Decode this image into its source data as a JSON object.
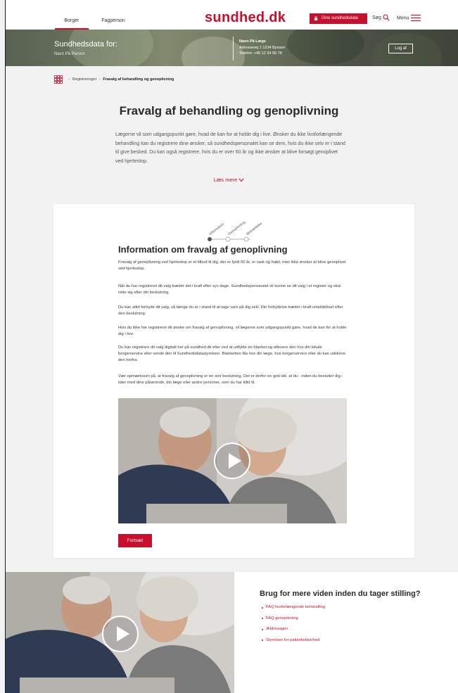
{
  "header": {
    "tabs": [
      {
        "label": "Borger",
        "active": true
      },
      {
        "label": "Fagperson",
        "active": false
      }
    ],
    "logo": "sundhed.dk",
    "my_data_button": "Dine sundhedsdata",
    "search_label": "Søg",
    "menu_label": "Menu",
    "accent_color": "#c8102e"
  },
  "banner": {
    "title": "Sundhedsdata for:",
    "person_name": "Navn På Person",
    "doctor": {
      "name": "Navn På Læge",
      "address": "Adressevej 1 1234 Bynavn",
      "phone": "Telefon: +45 12 34 56 78"
    },
    "logout_button": "Log af"
  },
  "breadcrumb": {
    "items": [
      "Registreringer",
      "Fravalg af behandling og genoplivning"
    ]
  },
  "intro": {
    "title": "Fravalg af behandling og genoplivning",
    "text": "Lægerne vil som udgangspunkt gøre, hvad de kan for at holde dig i live. Ønsker du ikke livsforlængende behandling kan du registrere dine ønsker, så sundhedspersonalet kan se dem, hvis du ikke selv er i stand til give besked. Du kan også registrere, hvis du er over 60 år og ikke ønsker at blive forsøgt genoplivet ved hjertestop.",
    "read_more": "Læs mere"
  },
  "stepper": {
    "steps": [
      "Information",
      "Genoplivning",
      "Bekræftelse"
    ],
    "current_step": 1
  },
  "card": {
    "title": "Information om fravalg af genoplivning",
    "paragraphs": [
      "Fravalg af genoplivning ved hjertestop er et tilbud til dig, der er fyldt 60 år, er rask og habil, men ikke ønsker at blive genoplivet ved hjertestop.",
      "Når du har registreret dit valg træder det i kraft efter syv dage. Sundhedspersonalet vil kunne se dit valg i et register og skal rette sig efter din beslutning.",
      "Du kan altid fortryde dit valg, så længe du er i stand til at tage vare på dig selv. Din fortrydelse træder i kraft umiddelbart efter den beslutning.",
      "Hvis du ikke har registreret dit ønske om fravalg af genoplivning, vil lægerne som udgangspunkt gøre, hvad de kan for at holde dig i live.",
      "Du kan registrere dit valg digitalt her på sundhed.dk eller ved at udfylde en blanket og aflevere den hos din lokale borgerservice eller sende den til Sundhedsdatastyrelsen. Blanketten fås hos din læge, hos borgerservice eller du kan udskrive den herfra.",
      "Vær opmærksom på, at fravalg af genoplivning er en stor beslutning. Det er derfor en god idé, at du - inden du beslutter dig - taler med dine pårørende, din læge eller andre personer, som du har tillid til."
    ],
    "continue_button": "Fortsæt"
  },
  "more_info": {
    "title": "Brug for mere viden inden du tager stilling?",
    "links": [
      "FAQ livsforlængende behandling",
      "FAQ genoplivning",
      "Ældresagen",
      "Styrelsen for patientsikkerhed"
    ]
  }
}
